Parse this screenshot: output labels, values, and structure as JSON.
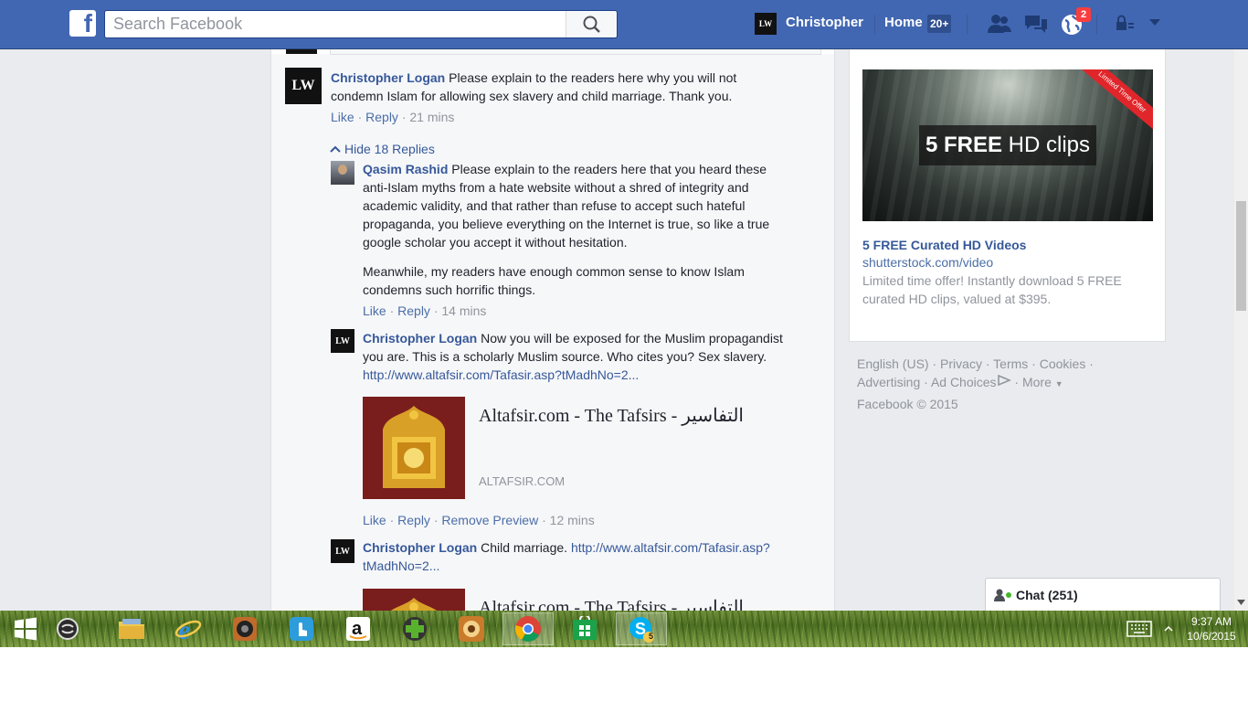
{
  "topbar": {
    "logo_letter": "f",
    "search_placeholder": "Search Facebook",
    "user_avatar_text": "LW",
    "user_name": "Christopher",
    "home_label": "Home",
    "home_count": "20+",
    "notifications_count": "2"
  },
  "comments": {
    "main": {
      "avatar_text": "LW",
      "author": "Christopher Logan",
      "text": " Please explain to the readers here why you will not condemn Islam for allowing sex slavery and child marriage. Thank you.",
      "like": "Like",
      "reply": "Reply",
      "time": "21 mins",
      "hide_replies": "Hide 18 Replies"
    },
    "replies": [
      {
        "author": "Qasim Rashid",
        "text": " Please explain to the readers here that you heard these anti-Islam myths from a hate website without a shred of integrity and academic validity, and that rather than refuse to accept such hateful propaganda, you believe everything on the Internet is true, so like a true google scholar you accept it without hesitation.",
        "text2": "Meanwhile, my readers have enough common sense to know Islam condemns such horrific things.",
        "like": "Like",
        "reply": "Reply",
        "time": "14 mins"
      },
      {
        "avatar_text": "LW",
        "author": "Christopher Logan",
        "text": " Now you will be exposed for the Muslim propagandist you are. This is a scholarly Muslim source. Who cites you? Sex slavery. ",
        "link": "http://www.altafsir.com/Tafasir.asp?tMadhNo=2...",
        "preview_title": "Altafsir.com - The Tafsirs - التفاسير",
        "preview_domain": "ALTAFSIR.COM",
        "like": "Like",
        "reply": "Reply",
        "remove_preview": "Remove Preview",
        "time": "12 mins"
      },
      {
        "avatar_text": "LW",
        "author": "Christopher Logan",
        "text": " Child marriage. ",
        "link": "http://www.altafsir.com/Tafasir.asp?tMadhNo=2...",
        "preview_title": "Altafsir.com - The Tafsirs - التفاسير"
      }
    ]
  },
  "ad": {
    "image_text_bold": "5 FREE",
    "image_text_rest": " HD clips",
    "ribbon": "Limited Time Offer",
    "title": "5 FREE Curated HD Videos",
    "url": "shutterstock.com/video",
    "description": "Limited time offer! Instantly download 5 FREE curated HD clips, valued at $395."
  },
  "footer": {
    "links": [
      "English (US)",
      "Privacy",
      "Terms",
      "Cookies",
      "Advertising",
      "Ad Choices",
      "More"
    ],
    "copyright": "Facebook © 2015"
  },
  "chat": {
    "label": "Chat (251)"
  },
  "taskbar": {
    "time": "9:37 AM",
    "date": "10/6/2015",
    "skype_badge": "5"
  },
  "colors": {
    "facebook_blue": "#4267b2",
    "link_blue": "#365899",
    "meta_gray": "#90949c",
    "badge_red": "#fa3e3e"
  }
}
